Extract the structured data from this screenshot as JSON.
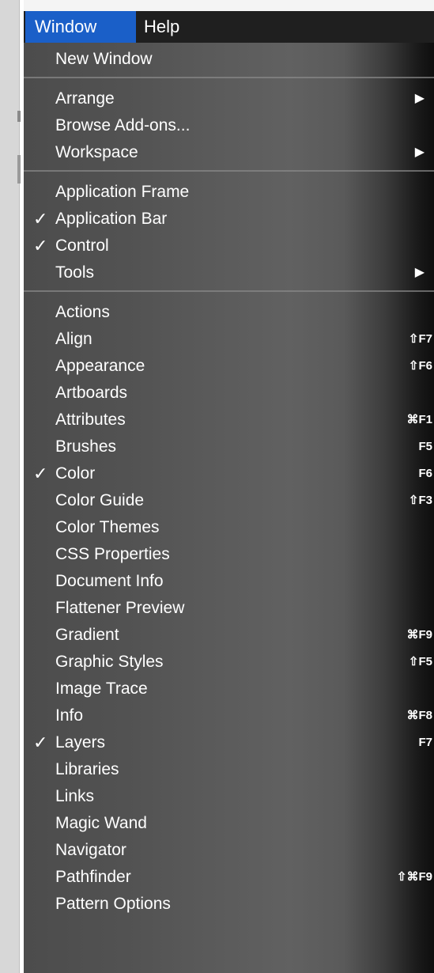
{
  "menubar": {
    "window_label": "Window",
    "help_label": "Help"
  },
  "menu": {
    "groups": [
      [
        {
          "label": "New Window",
          "checked": false,
          "submenu": false,
          "shortcut": ""
        }
      ],
      [
        {
          "label": "Arrange",
          "checked": false,
          "submenu": true,
          "shortcut": ""
        },
        {
          "label": "Browse Add-ons...",
          "checked": false,
          "submenu": false,
          "shortcut": ""
        },
        {
          "label": "Workspace",
          "checked": false,
          "submenu": true,
          "shortcut": ""
        }
      ],
      [
        {
          "label": "Application Frame",
          "checked": false,
          "submenu": false,
          "shortcut": ""
        },
        {
          "label": "Application Bar",
          "checked": true,
          "submenu": false,
          "shortcut": ""
        },
        {
          "label": "Control",
          "checked": true,
          "submenu": false,
          "shortcut": ""
        },
        {
          "label": "Tools",
          "checked": false,
          "submenu": true,
          "shortcut": ""
        }
      ],
      [
        {
          "label": "Actions",
          "checked": false,
          "submenu": false,
          "shortcut": ""
        },
        {
          "label": "Align",
          "checked": false,
          "submenu": false,
          "shortcut": "⇧F7"
        },
        {
          "label": "Appearance",
          "checked": false,
          "submenu": false,
          "shortcut": "⇧F6"
        },
        {
          "label": "Artboards",
          "checked": false,
          "submenu": false,
          "shortcut": ""
        },
        {
          "label": "Attributes",
          "checked": false,
          "submenu": false,
          "shortcut": "⌘F1"
        },
        {
          "label": "Brushes",
          "checked": false,
          "submenu": false,
          "shortcut": "F5"
        },
        {
          "label": "Color",
          "checked": true,
          "submenu": false,
          "shortcut": "F6"
        },
        {
          "label": "Color Guide",
          "checked": false,
          "submenu": false,
          "shortcut": "⇧F3"
        },
        {
          "label": "Color Themes",
          "checked": false,
          "submenu": false,
          "shortcut": ""
        },
        {
          "label": "CSS Properties",
          "checked": false,
          "submenu": false,
          "shortcut": ""
        },
        {
          "label": "Document Info",
          "checked": false,
          "submenu": false,
          "shortcut": ""
        },
        {
          "label": "Flattener Preview",
          "checked": false,
          "submenu": false,
          "shortcut": ""
        },
        {
          "label": "Gradient",
          "checked": false,
          "submenu": false,
          "shortcut": "⌘F9"
        },
        {
          "label": "Graphic Styles",
          "checked": false,
          "submenu": false,
          "shortcut": "⇧F5"
        },
        {
          "label": "Image Trace",
          "checked": false,
          "submenu": false,
          "shortcut": ""
        },
        {
          "label": "Info",
          "checked": false,
          "submenu": false,
          "shortcut": "⌘F8"
        },
        {
          "label": "Layers",
          "checked": true,
          "submenu": false,
          "shortcut": "F7"
        },
        {
          "label": "Libraries",
          "checked": false,
          "submenu": false,
          "shortcut": ""
        },
        {
          "label": "Links",
          "checked": false,
          "submenu": false,
          "shortcut": ""
        },
        {
          "label": "Magic Wand",
          "checked": false,
          "submenu": false,
          "shortcut": ""
        },
        {
          "label": "Navigator",
          "checked": false,
          "submenu": false,
          "shortcut": ""
        },
        {
          "label": "Pathfinder",
          "checked": false,
          "submenu": false,
          "shortcut": "⇧⌘F9"
        },
        {
          "label": "Pattern Options",
          "checked": false,
          "submenu": false,
          "shortcut": ""
        }
      ]
    ]
  },
  "icons": {
    "check": "check-icon",
    "submenu_arrow": "triangle-right-icon"
  },
  "colors": {
    "menubar_bg": "#1f1f1f",
    "active_title": "#1a5fc8",
    "text": "#ffffff"
  }
}
